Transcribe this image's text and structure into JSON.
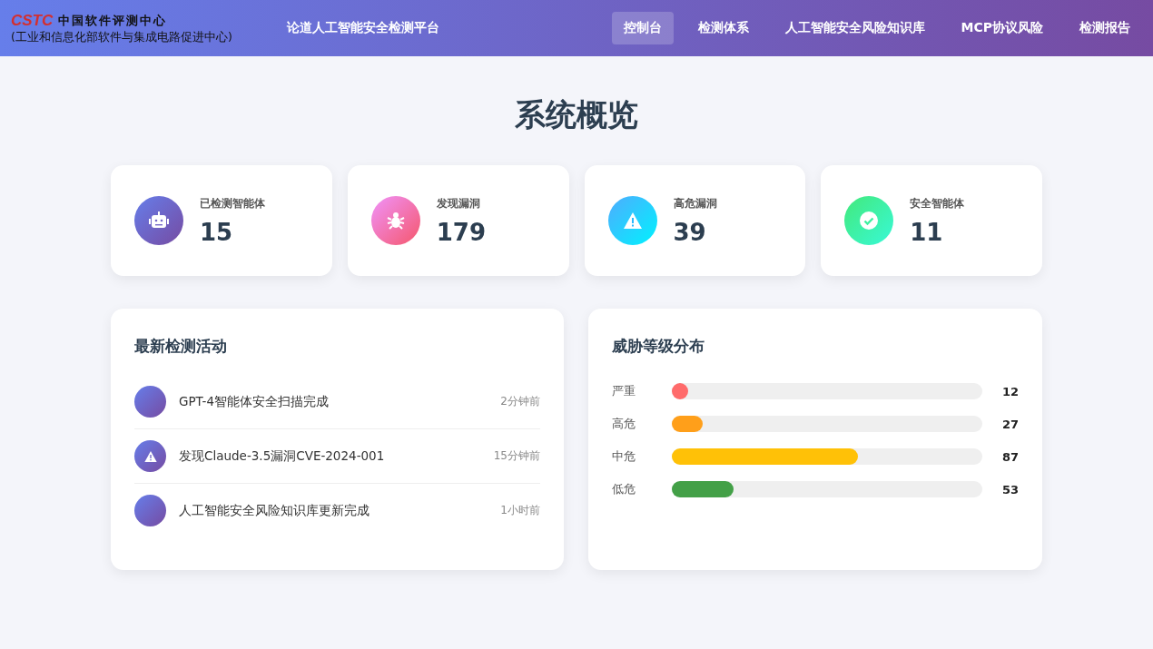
{
  "header": {
    "logo": "CSTC",
    "org_name": "中国软件评测中心",
    "org_subtitle": "(工业和信息化部软件与集成电路促进中心)",
    "platform_title": "论道人工智能安全检测平台"
  },
  "nav": [
    {
      "label": "控制台",
      "selected": true
    },
    {
      "label": "检测体系",
      "selected": false
    },
    {
      "label": "人工智能安全风险知识库",
      "selected": false
    },
    {
      "label": "MCP协议风险",
      "selected": false
    },
    {
      "label": "检测报告",
      "selected": false
    }
  ],
  "page_title": "系统概览",
  "stats": [
    {
      "kind": "robot",
      "label": "已检测智能体",
      "value": "15"
    },
    {
      "kind": "bug",
      "label": "发现漏洞",
      "value": "179"
    },
    {
      "kind": "warning",
      "label": "高危漏洞",
      "value": "39"
    },
    {
      "kind": "check",
      "label": "安全智能体",
      "value": "11"
    }
  ],
  "activity": {
    "title": "最新检测活动",
    "items": [
      {
        "kind": "plain",
        "text": "GPT-4智能体安全扫描完成",
        "time": "2分钟前"
      },
      {
        "kind": "warning",
        "text": "发现Claude-3.5漏洞CVE-2024-001",
        "time": "15分钟前"
      },
      {
        "kind": "plain",
        "text": "人工智能安全风险知识库更新完成",
        "time": "1小时前"
      }
    ]
  },
  "threats": {
    "title": "威胁等级分布",
    "levels": [
      {
        "label": "严重",
        "level": 0.05,
        "count": "12",
        "color": "#ff6b6b"
      },
      {
        "label": "高危",
        "level": 0.1,
        "count": "27",
        "color": "#ff9f1a"
      },
      {
        "label": "中危",
        "level": 0.6,
        "count": "87",
        "color": "#ffc107"
      },
      {
        "label": "低危",
        "level": 0.2,
        "count": "53",
        "color": "#43a047"
      }
    ]
  }
}
